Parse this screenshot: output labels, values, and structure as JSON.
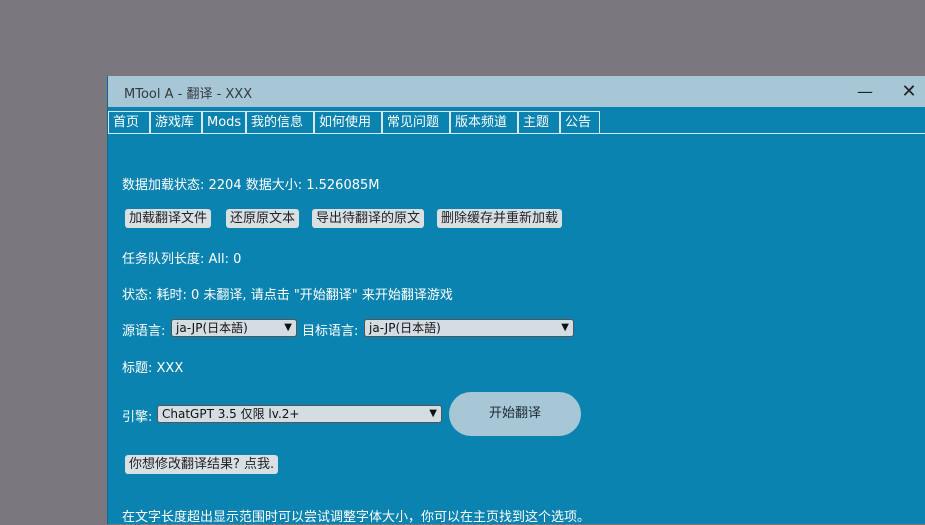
{
  "window": {
    "title": "MTool A - 翻译 - XXX",
    "minimize_glyph": "—",
    "close_glyph": "✕"
  },
  "tabs": [
    {
      "label": "首页"
    },
    {
      "label": "游戏库"
    },
    {
      "label": "Mods"
    },
    {
      "label": "我的信息"
    },
    {
      "label": "如何使用"
    },
    {
      "label": "常见问题"
    },
    {
      "label": "版本频道"
    },
    {
      "label": "主题"
    },
    {
      "label": "公告"
    }
  ],
  "main": {
    "data_status": "数据加载状态: 2204 数据大小: 1.526085M",
    "buttons": {
      "load": "加载翻译文件",
      "restore": "还原原文本",
      "export": "导出待翻译的原文",
      "clear_cache": "删除缓存并重新加载"
    },
    "queue_length": "任务队列长度: All: 0",
    "status": "状态: 耗时: 0 未翻译, 请点击 \"开始翻译\" 来开始翻译游戏",
    "source_lang_label": "源语言:",
    "source_lang_value": "ja-JP(日本語)",
    "target_lang_label": "目标语言:",
    "target_lang_value": "ja-JP(日本語)",
    "title_line": "标题: XXX",
    "engine_label": "引擎:",
    "engine_value": "ChatGPT 3.5 仅限 lv.2+",
    "start_button": "开始翻译",
    "modify_button": "你想修改翻译结果? 点我.",
    "hint": "在文字长度超出显示范围时可以尝试调整字体大小，你可以在主页找到这个选项。"
  },
  "colors": {
    "window_bg": "#0a83b0",
    "titlebar_bg": "#a7c6d6",
    "desktop_bg": "#7a787c",
    "button_bg": "#d9e0e4"
  }
}
